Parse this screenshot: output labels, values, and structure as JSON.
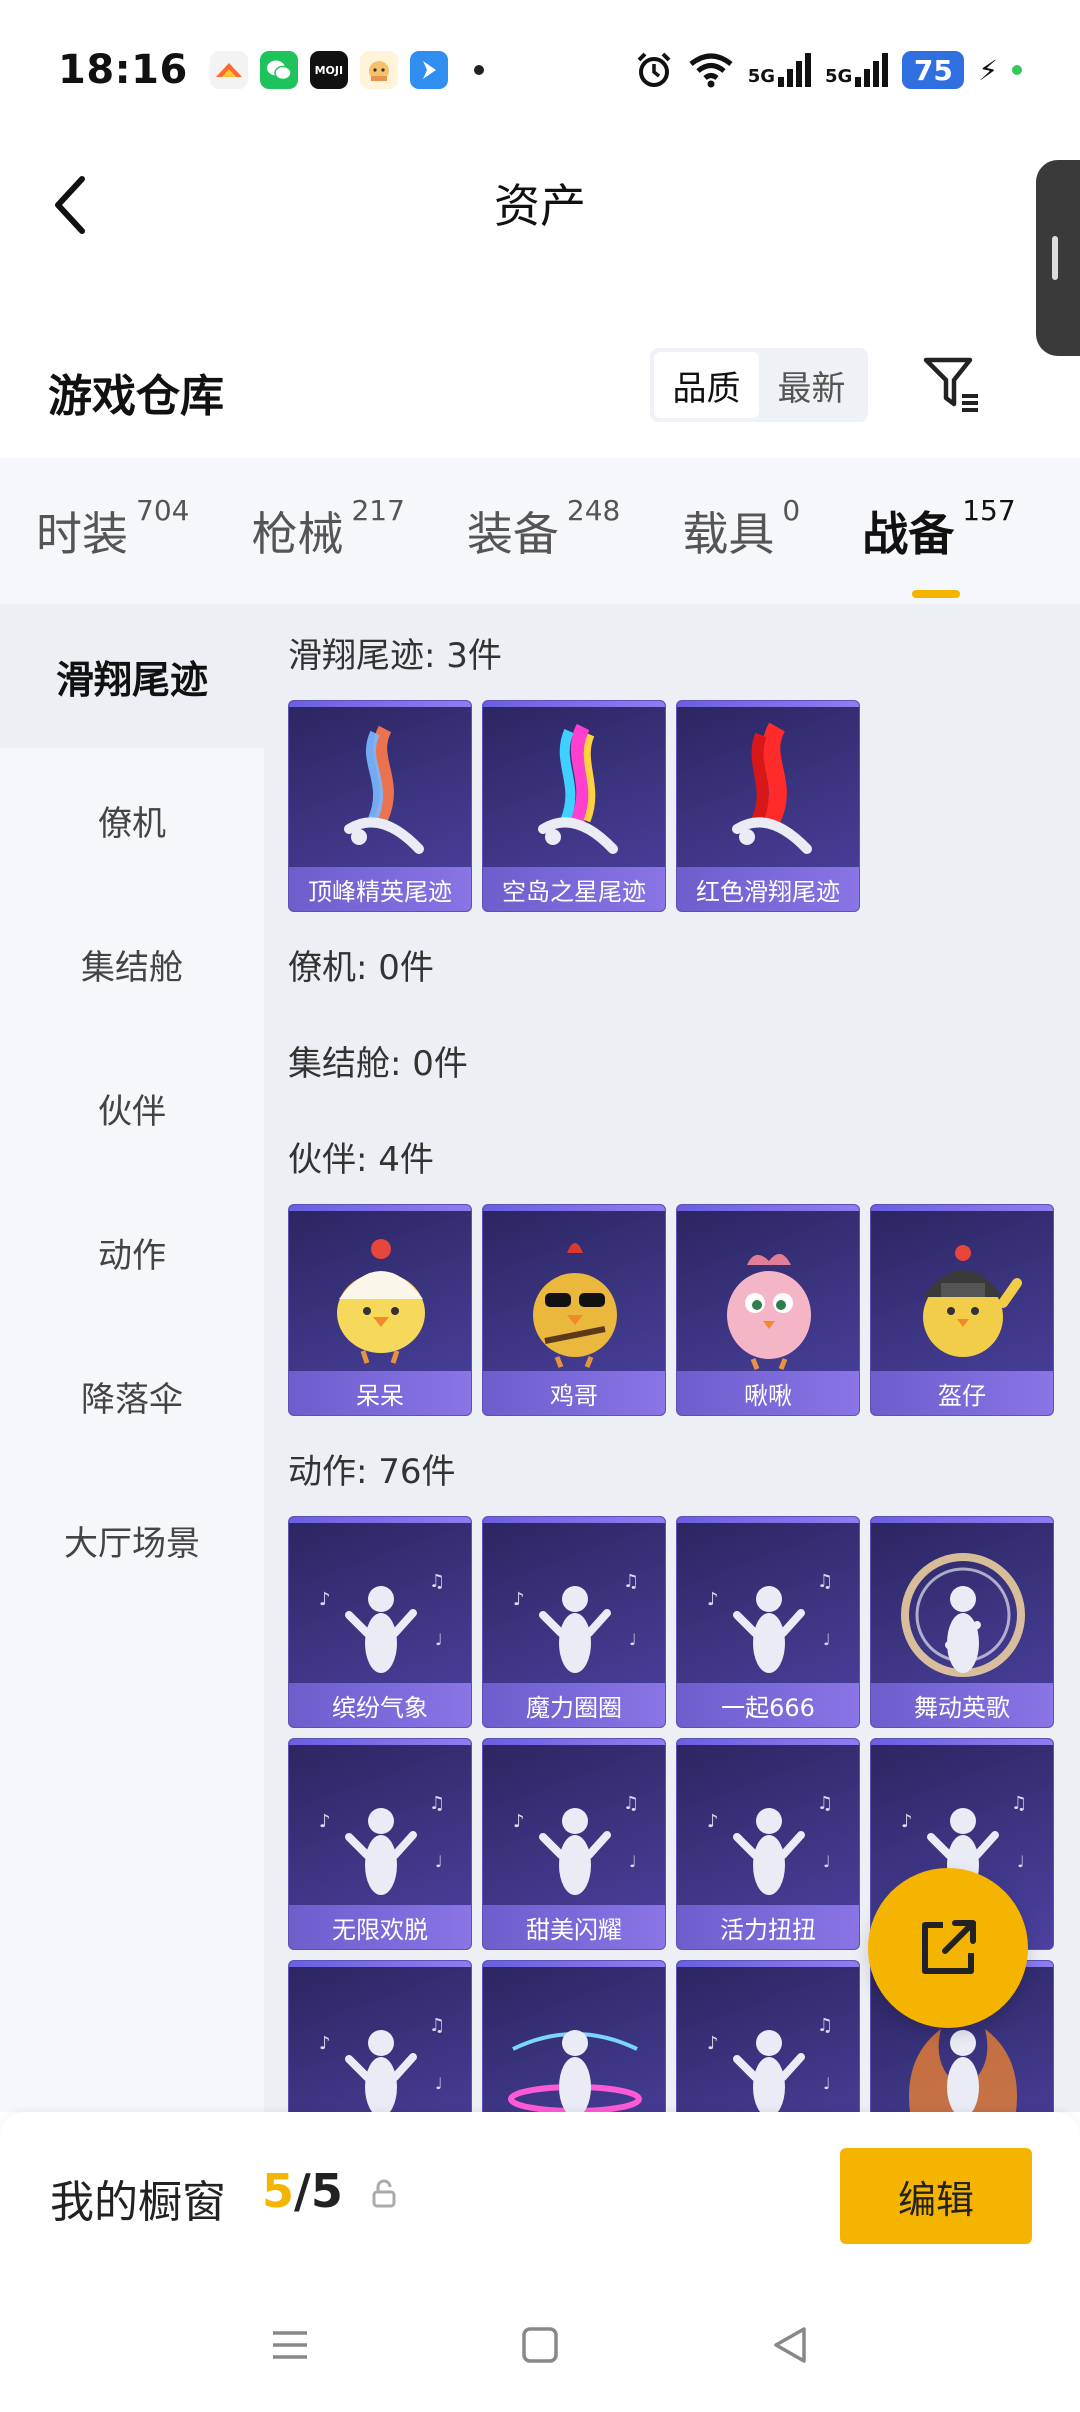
{
  "status_bar": {
    "time": "18:16",
    "battery": "75",
    "network_label": "5G",
    "app_icons": [
      "game-icon",
      "wechat-icon",
      "moji-weather-icon",
      "xiaomao-icon",
      "relay-icon"
    ]
  },
  "header": {
    "title": "资产"
  },
  "section": {
    "title": "游戏仓库",
    "sort_options": [
      {
        "label": "品质",
        "active": true
      },
      {
        "label": "最新",
        "active": false
      }
    ]
  },
  "tabs": [
    {
      "label": "时装",
      "count": "704",
      "active": false
    },
    {
      "label": "枪械",
      "count": "217",
      "active": false
    },
    {
      "label": "装备",
      "count": "248",
      "active": false
    },
    {
      "label": "载具",
      "count": "0",
      "active": false
    },
    {
      "label": "战备",
      "count": "157",
      "active": true
    }
  ],
  "side_nav": [
    {
      "label": "滑翔尾迹",
      "active": true
    },
    {
      "label": "僚机",
      "active": false
    },
    {
      "label": "集结舱",
      "active": false
    },
    {
      "label": "伙伴",
      "active": false
    },
    {
      "label": "动作",
      "active": false
    },
    {
      "label": "降落伞",
      "active": false
    },
    {
      "label": "大厅场景",
      "active": false
    }
  ],
  "groups": [
    {
      "title": "滑翔尾迹: 3件",
      "items": [
        {
          "name": "顶峰精英尾迹",
          "art": "trail-rainbow"
        },
        {
          "name": "空岛之星尾迹",
          "art": "trail-neon"
        },
        {
          "name": "红色滑翔尾迹",
          "art": "trail-red"
        }
      ]
    },
    {
      "title": "僚机: 0件",
      "items": []
    },
    {
      "title": "集结舱: 0件",
      "items": []
    },
    {
      "title": "伙伴: 4件",
      "items": [
        {
          "name": "呆呆",
          "art": "chick-egg"
        },
        {
          "name": "鸡哥",
          "art": "chick-glasses"
        },
        {
          "name": "啾啾",
          "art": "pink-bird"
        },
        {
          "name": "盔仔",
          "art": "chick-helmet"
        }
      ]
    },
    {
      "title": "动作: 76件",
      "items": [
        {
          "name": "缤纷气象",
          "art": "dance"
        },
        {
          "name": "魔力圈圈",
          "art": "dance"
        },
        {
          "name": "一起666",
          "art": "dance"
        },
        {
          "name": "舞动英歌",
          "art": "dance-ring"
        },
        {
          "name": "无限欢脱",
          "art": "dance"
        },
        {
          "name": "甜美闪耀",
          "art": "dance"
        },
        {
          "name": "活力扭扭",
          "art": "dance"
        },
        {
          "name": "",
          "art": "dance"
        },
        {
          "name": "",
          "art": "dance"
        },
        {
          "name": "",
          "art": "dance-hoop"
        },
        {
          "name": "",
          "art": "dance"
        },
        {
          "name": "",
          "art": "dance-fire"
        }
      ]
    }
  ],
  "bottom_bar": {
    "showcase_label": "我的橱窗",
    "showcase_used": "5",
    "showcase_sep": "/",
    "showcase_total": "5",
    "edit_label": "编辑"
  },
  "colors": {
    "accent": "#f5b400",
    "card_bg": "#3d3684",
    "card_label": "#7a68d8"
  }
}
